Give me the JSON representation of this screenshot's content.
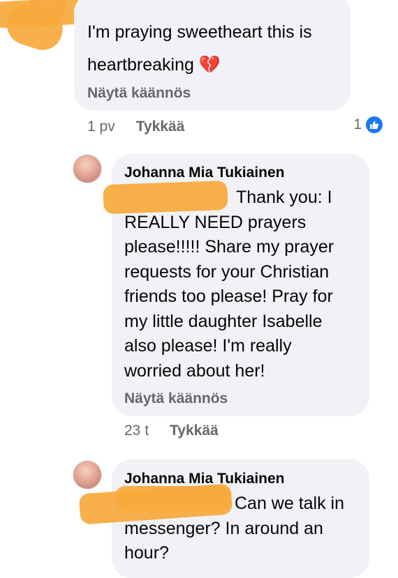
{
  "comments": [
    {
      "lines": [
        "I'm praying sweetheart this is",
        "heartbreaking"
      ],
      "emoji": "💔",
      "translate_label": "Näytä käännös",
      "time": "1 pv",
      "like_label": "Tykkää",
      "reaction_count": "1",
      "reaction_icon": "thumbs-up-icon"
    },
    {
      "author": "Johanna Mia Tukiainen",
      "lines": [
        "Thank you: I",
        "REALLY NEED prayers",
        "please!!!!! Share my prayer",
        "requests for your Christian",
        "friends too please! Pray for",
        "my little daughter Isabelle",
        "also please! I'm really",
        "worried about her!"
      ],
      "translate_label": "Näytä käännös",
      "time": "23 t",
      "like_label": "Tykkää"
    },
    {
      "author": "Johanna Mia Tukiainen",
      "lines": [
        "Can we talk in",
        "messenger? In around an",
        "hour?"
      ]
    }
  ],
  "colors": {
    "bubble": "#f0f2f5",
    "redaction": "#f7a93b",
    "secondary_text": "#65676b",
    "like_blue": "#1877f2"
  }
}
